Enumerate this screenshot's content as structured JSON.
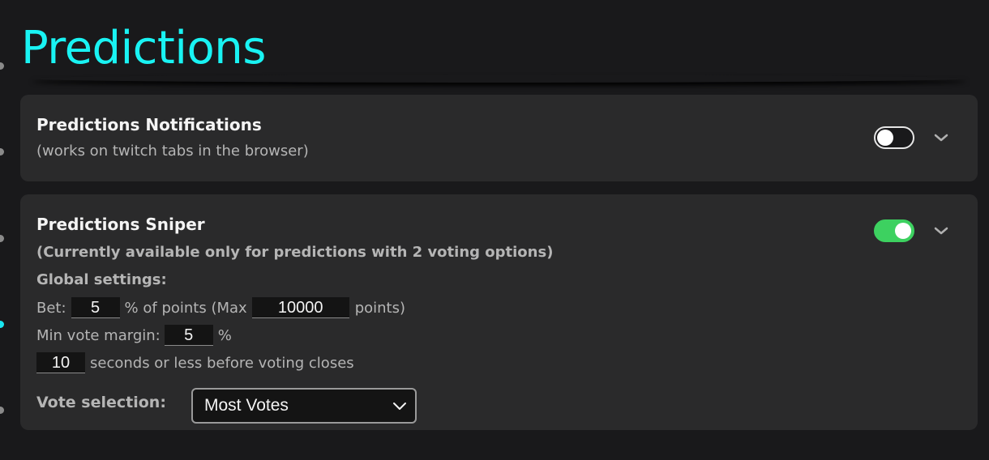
{
  "page": {
    "title": "Predictions"
  },
  "notifications": {
    "title": "Predictions Notifications",
    "subtitle": "(works on twitch tabs in the browser)",
    "enabled": false
  },
  "sniper": {
    "title": "Predictions Sniper",
    "note": "(Currently available only for predictions with 2 voting options)",
    "enabled": true,
    "global_settings_label": "Global settings:",
    "bet": {
      "label": "Bet:",
      "percent_value": "5",
      "percent_suffix": "% of points (Max",
      "max_value": "10000",
      "max_suffix": "points)"
    },
    "min_vote_margin": {
      "label": "Min vote margin:",
      "value": "5",
      "suffix": "%"
    },
    "seconds": {
      "value": "10",
      "suffix": "seconds or less before voting closes"
    },
    "vote_selection": {
      "label": "Vote selection:",
      "selected": "Most Votes"
    }
  },
  "colors": {
    "accent": "#19f3f3",
    "toggle_on": "#3dd160",
    "card_bg": "#2a2a2b",
    "page_bg": "#19191b"
  },
  "icons": {
    "expand": "chevron-down-icon",
    "select_arrow": "chevron-down-icon"
  }
}
